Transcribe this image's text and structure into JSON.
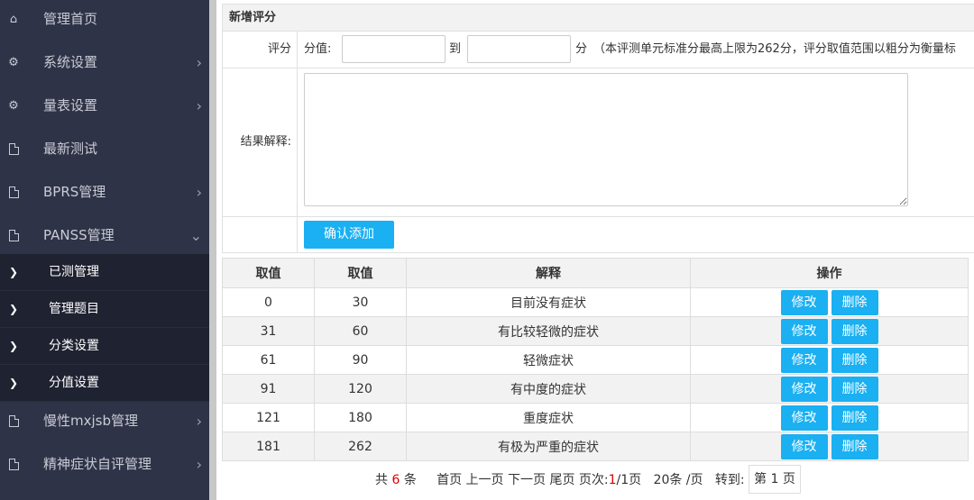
{
  "sidebar": {
    "items": [
      {
        "label": "管理首页",
        "icon": "home-icon",
        "chevron": false
      },
      {
        "label": "系统设置",
        "icon": "gear-icon",
        "chevron": true
      },
      {
        "label": "量表设置",
        "icon": "gear-icon",
        "chevron": true
      },
      {
        "label": "最新测试",
        "icon": "document-icon",
        "chevron": false
      },
      {
        "label": "BPRS管理",
        "icon": "document-icon",
        "chevron": true
      },
      {
        "label": "PANSS管理",
        "icon": "document-icon",
        "chevron": true,
        "expanded": true
      }
    ],
    "sub_items": [
      {
        "label": "已测管理"
      },
      {
        "label": "管理题目"
      },
      {
        "label": "分类设置"
      },
      {
        "label": "分值设置"
      }
    ],
    "items_after": [
      {
        "label": "慢性mxjsb管理",
        "icon": "document-icon"
      },
      {
        "label": "精神症状自评管理",
        "icon": "document-icon"
      }
    ]
  },
  "form": {
    "title": "新增评分",
    "score_label": "评分",
    "value_label": "分值:",
    "to_label": "到",
    "unit_label": "分",
    "hint": "（本评测单元标准分最高上限为262分，评分取值范围以粗分为衡量标",
    "result_label": "结果解释:",
    "submit_label": "确认添加",
    "from_value": "",
    "to_value": "",
    "result_value": ""
  },
  "table": {
    "headers": [
      "取值",
      "取值",
      "解释",
      "操作"
    ],
    "rows": [
      {
        "min": "0",
        "max": "30",
        "desc": "目前没有症状"
      },
      {
        "min": "31",
        "max": "60",
        "desc": "有比较轻微的症状"
      },
      {
        "min": "61",
        "max": "90",
        "desc": "轻微症状"
      },
      {
        "min": "91",
        "max": "120",
        "desc": "有中度的症状"
      },
      {
        "min": "121",
        "max": "180",
        "desc": "重度症状"
      },
      {
        "min": "181",
        "max": "262",
        "desc": "有极为严重的症状"
      }
    ],
    "edit_label": "修改",
    "delete_label": "删除"
  },
  "pager": {
    "total_prefix": "共",
    "total": "6",
    "total_suffix": "条",
    "first": "首页",
    "prev": "上一页",
    "next": "下一页",
    "last": "尾页",
    "page_label": "页次:",
    "current": "1",
    "of_pages": "/1页",
    "per_page": "20条 /页",
    "goto_label": "转到:",
    "page_select": "第 1 页"
  },
  "colors": {
    "sidebar_bg": "#2f3347",
    "accent": "#1ab0f2",
    "sub_bg": "#1f2231"
  }
}
